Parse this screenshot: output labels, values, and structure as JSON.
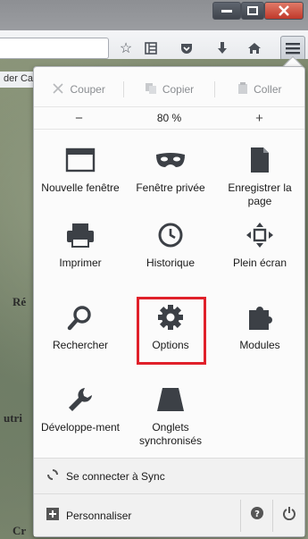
{
  "browser": {
    "bookmark_tab": "der Ca"
  },
  "map": {
    "labels": [
      "Ré",
      "utri",
      "Cr"
    ]
  },
  "menu": {
    "edit": {
      "cut": "Couper",
      "copy": "Copier",
      "paste": "Coller"
    },
    "zoom": {
      "minus": "−",
      "value": "80 %",
      "plus": "+"
    },
    "items": [
      {
        "label": "Nouvelle fenêtre",
        "icon": "new-window-icon"
      },
      {
        "label": "Fenêtre privée",
        "icon": "private-mask-icon"
      },
      {
        "label": "Enregistrer la page",
        "icon": "save-page-icon"
      },
      {
        "label": "Imprimer",
        "icon": "printer-icon"
      },
      {
        "label": "Historique",
        "icon": "history-clock-icon"
      },
      {
        "label": "Plein écran",
        "icon": "fullscreen-icon"
      },
      {
        "label": "Rechercher",
        "icon": "search-icon"
      },
      {
        "label": "Options",
        "icon": "gear-icon"
      },
      {
        "label": "Modules",
        "icon": "puzzle-icon"
      },
      {
        "label": "Développe-ment",
        "icon": "wrench-icon"
      },
      {
        "label": "Onglets synchronisés",
        "icon": "synced-tabs-icon"
      }
    ],
    "sync_label": "Se connecter à Sync",
    "customize_label": "Personnaliser",
    "highlight_color": "#e0202a"
  }
}
